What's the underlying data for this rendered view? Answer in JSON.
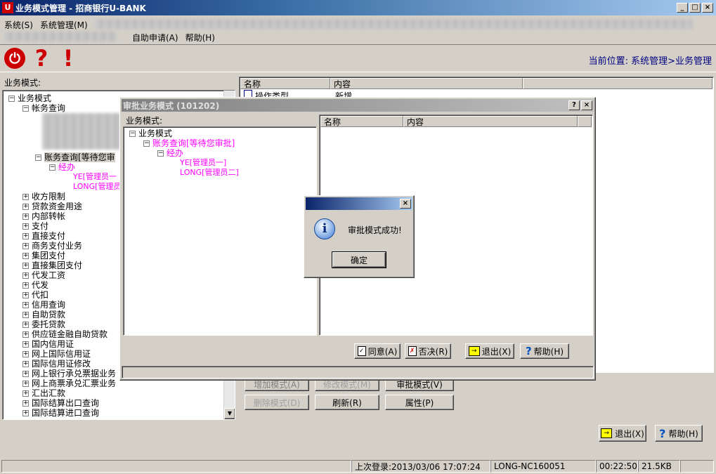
{
  "main_window": {
    "title": "业务模式管理 - 招商银行U-BANK",
    "menu": [
      "系统(S)",
      "系统管理(M)"
    ],
    "menu2": [
      "自助申请(A)",
      "帮助(H)"
    ],
    "location": "当前位置: 系统管理>业务管理"
  },
  "left_panel": {
    "label": "业务模式:",
    "root": "业务模式",
    "account_query": "帐务查询",
    "account_pending": "账务查询[等待您审",
    "handler": "经办",
    "ye": "YE[管理员一",
    "long": "LONG[管理员",
    "items": [
      "收方限制",
      "贷款资金用途",
      "内部转帐",
      "支付",
      "直接支付",
      "商务支付业务",
      "集团支付",
      "直接集团支付",
      "代发工资",
      "代发",
      "代扣",
      "信用查询",
      "自助贷款",
      "委托贷款",
      "供应链金融自助贷款",
      "国内信用证",
      "网上国际信用证",
      "国际信用证修改",
      "网上银行承兑票据业务",
      "网上商票承兑汇票业务",
      "汇出汇款",
      "国际结算出口查询",
      "国际结算进口查询"
    ]
  },
  "right_table": {
    "headers": [
      "名称",
      "内容"
    ],
    "row1": [
      "操作类型",
      "新增"
    ]
  },
  "right_buttons": {
    "add": "增加模式(A)",
    "modify": "修改模式(M)",
    "approve": "审批模式(V)",
    "delete": "删除模式(D)",
    "refresh": "刷新(R)",
    "props": "属性(P)"
  },
  "main_buttons": {
    "exit": "退出(X)",
    "help": "帮助(H)"
  },
  "status": {
    "last_login": "上次登录:2013/03/06 17:07:24",
    "machine": "LONG-NC160051",
    "time": "00:22:50",
    "size": "21.5KB"
  },
  "approve_dialog": {
    "title": "审批业务模式 (101202)",
    "label": "业务模式:",
    "root": "业务模式",
    "pending": "账务查询[等待您审批]",
    "handler": "经办",
    "ye": "YE[管理员一]",
    "long": "LONG[管理员二]",
    "headers": [
      "名称",
      "内容"
    ],
    "agree": "同意(A)",
    "reject": "否决(R)",
    "exit": "退出(X)",
    "help": "帮助(H)"
  },
  "msg_box": {
    "message": "审批模式成功!",
    "ok": "确定"
  },
  "colors": {
    "accent": "#0a246a",
    "pink": "#ff00ff",
    "face": "#d4d0c8"
  }
}
